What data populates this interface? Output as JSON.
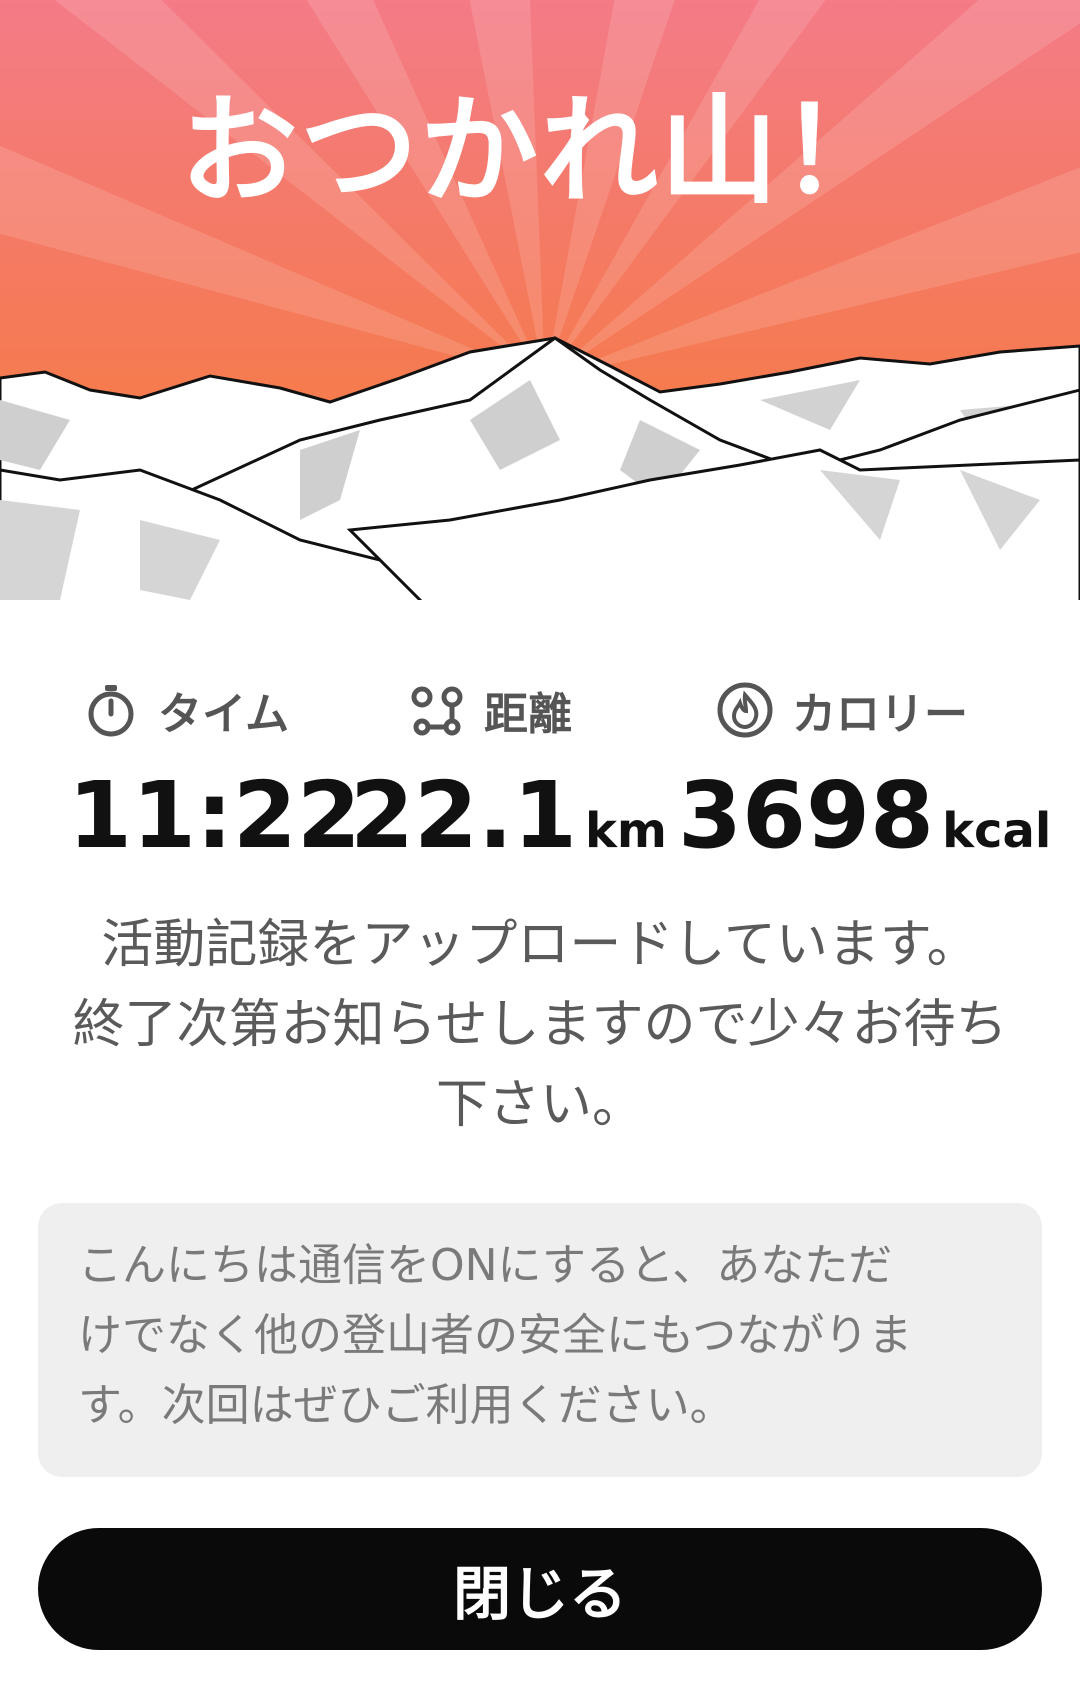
{
  "header": {
    "title": "おつかれ山！"
  },
  "stats": {
    "time": {
      "label": "タイム",
      "value": "11:22",
      "icon": "stopwatch-icon"
    },
    "distance": {
      "label": "距離",
      "value": "22.1",
      "unit": "km",
      "icon": "route-icon"
    },
    "calories": {
      "label": "カロリー",
      "value": "3698",
      "unit": "kcal",
      "icon": "flame-icon"
    }
  },
  "upload_message": {
    "line1": "活動記録をアップロードしています。",
    "line2": "終了次第お知らせしますので少々お待ち",
    "line3": "下さい。"
  },
  "notice": {
    "line1": "こんにちは通信をONにすると、あなただ",
    "line2": "けでなく他の登山者の安全にもつながりま",
    "line3": "す。次回はぜひご利用ください。"
  },
  "close_button": {
    "label": "閉じる"
  },
  "colors": {
    "sky_top": "#f47b8a",
    "sky_bottom": "#f7863a",
    "button": "#0a0a0a",
    "notice_bg": "#efefef"
  }
}
